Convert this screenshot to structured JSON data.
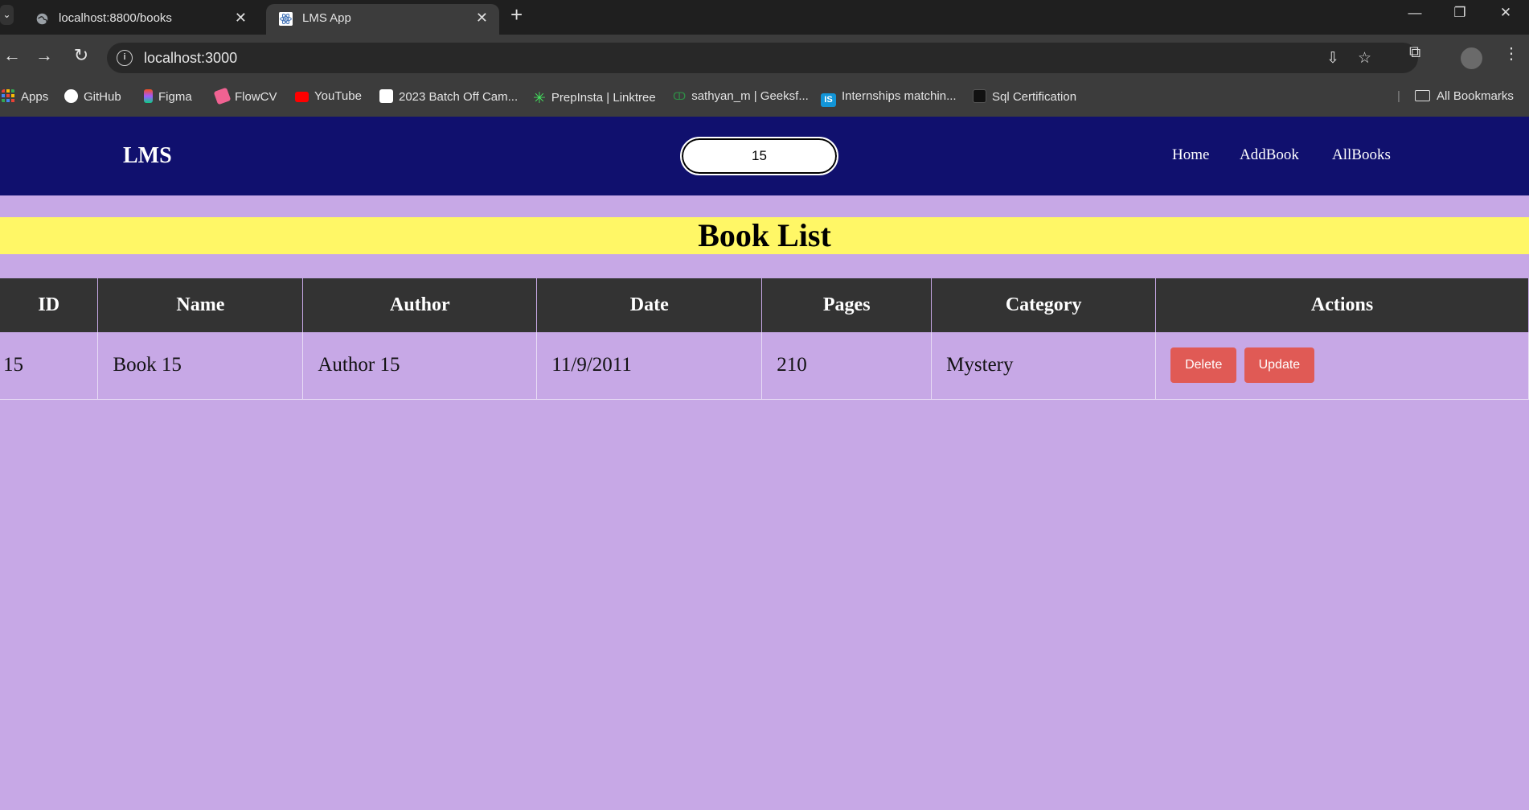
{
  "browser": {
    "tabs": [
      {
        "title": "localhost:8800/books",
        "icon": "globe-icon"
      },
      {
        "title": "LMS App",
        "icon": "react-icon"
      }
    ],
    "url": "localhost:3000",
    "bookmarks": [
      {
        "label": "Apps",
        "icon": "apps-grid-icon",
        "color": "#e94235"
      },
      {
        "label": "GitHub",
        "icon": "github-icon",
        "color": "#ffffff"
      },
      {
        "label": "Figma",
        "icon": "figma-icon",
        "color": "#f24e1e"
      },
      {
        "label": "FlowCV",
        "icon": "flowcv-icon",
        "color": "#f06292"
      },
      {
        "label": "YouTube",
        "icon": "youtube-icon",
        "color": "#ff0000"
      },
      {
        "label": "2023 Batch Off Cam...",
        "icon": "page-icon",
        "color": "#ffffff"
      },
      {
        "label": "PrepInsta | Linktree",
        "icon": "linktree-icon",
        "color": "#43e55e"
      },
      {
        "label": "sathyan_m | Geeksf...",
        "icon": "geeksforgeeks-icon",
        "color": "#2f8d46"
      },
      {
        "label": "Internships matchin...",
        "icon": "internshala-icon",
        "color": "#1295d8"
      },
      {
        "label": "Sql Certification",
        "icon": "hackerrank-icon",
        "color": "#111111"
      }
    ],
    "all_bookmarks": "All Bookmarks"
  },
  "app": {
    "brand": "LMS",
    "search_value": "15",
    "nav": [
      "Home",
      "AddBook",
      "AllBooks"
    ],
    "heading": "Book List",
    "table": {
      "columns": [
        "ID",
        "Name",
        "Author",
        "Date",
        "Pages",
        "Category",
        "Actions"
      ],
      "rows": [
        {
          "id": "15",
          "name": "Book 15",
          "author": "Author 15",
          "date": "11/9/2011",
          "pages": "210",
          "category": "Mystery"
        }
      ],
      "actions": {
        "delete": "Delete",
        "update": "Update"
      }
    }
  },
  "colors": {
    "navbar": "#10106e",
    "page_bg": "#c7a8e6",
    "banner": "#fff766",
    "table_header": "#333333",
    "action_button": "#e05a55"
  }
}
